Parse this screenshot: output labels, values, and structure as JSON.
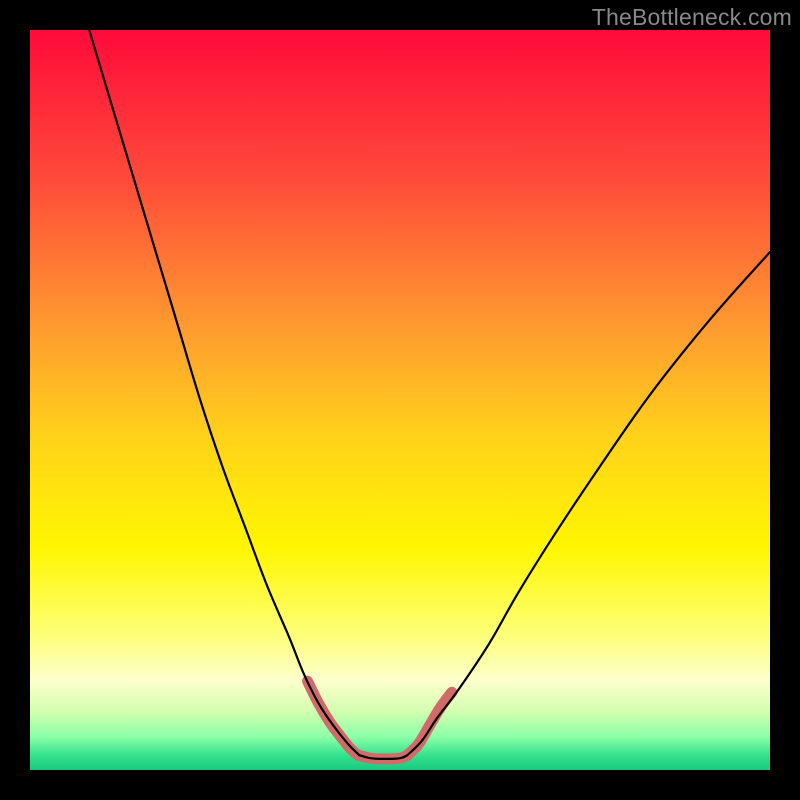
{
  "watermark": "TheBottleneck.com",
  "chart_data": {
    "type": "line",
    "title": "",
    "xlabel": "",
    "ylabel": "",
    "xlim": [
      0,
      100
    ],
    "ylim": [
      0,
      100
    ],
    "grid": false,
    "legend": false,
    "background_gradient": {
      "stops": [
        {
          "offset": 0.0,
          "color": "#ff0a3a"
        },
        {
          "offset": 0.2,
          "color": "#ff4a3a"
        },
        {
          "offset": 0.4,
          "color": "#ff9a30"
        },
        {
          "offset": 0.55,
          "color": "#ffd21a"
        },
        {
          "offset": 0.7,
          "color": "#fff600"
        },
        {
          "offset": 0.82,
          "color": "#fdff7a"
        },
        {
          "offset": 0.88,
          "color": "#fcffcc"
        },
        {
          "offset": 0.92,
          "color": "#d4ffb0"
        },
        {
          "offset": 0.955,
          "color": "#8cffa8"
        },
        {
          "offset": 0.98,
          "color": "#36e28e"
        },
        {
          "offset": 1.0,
          "color": "#18c97e"
        }
      ]
    },
    "series": [
      {
        "name": "curve-left",
        "color": "#000000",
        "width": 2.2,
        "x": [
          8,
          11,
          14,
          17,
          20,
          23,
          26,
          29,
          32,
          35,
          37,
          39,
          41,
          43,
          44.5
        ],
        "y": [
          100,
          90,
          80,
          70,
          60,
          50,
          41,
          33,
          25,
          18,
          13,
          9,
          6,
          3.5,
          2
        ]
      },
      {
        "name": "curve-right",
        "color": "#000000",
        "width": 2.2,
        "x": [
          51,
          53,
          55,
          58,
          62,
          66,
          71,
          77,
          84,
          92,
          100
        ],
        "y": [
          2,
          4,
          7,
          11,
          17,
          24,
          32,
          41,
          51,
          61,
          70
        ]
      },
      {
        "name": "flat-bottom",
        "color": "#000000",
        "width": 2.2,
        "x": [
          44.5,
          46,
          48,
          50,
          51
        ],
        "y": [
          2,
          1.6,
          1.5,
          1.6,
          2
        ]
      }
    ],
    "highlight_segments": [
      {
        "name": "highlight-left-descend",
        "color": "#d36a6a",
        "width": 11,
        "x": [
          37.5,
          39,
          40.5,
          42,
          43.2,
          44.3
        ],
        "y": [
          12,
          9,
          6.5,
          4.5,
          3,
          2
        ]
      },
      {
        "name": "highlight-flat",
        "color": "#d36a6a",
        "width": 11,
        "x": [
          44.3,
          46,
          48,
          50,
          51
        ],
        "y": [
          2,
          1.6,
          1.5,
          1.6,
          2
        ]
      },
      {
        "name": "highlight-right-ascend",
        "color": "#d36a6a",
        "width": 11,
        "x": [
          51,
          52.5,
          54,
          55.5,
          57
        ],
        "y": [
          2,
          3.5,
          6,
          8.5,
          10.5
        ]
      }
    ]
  }
}
